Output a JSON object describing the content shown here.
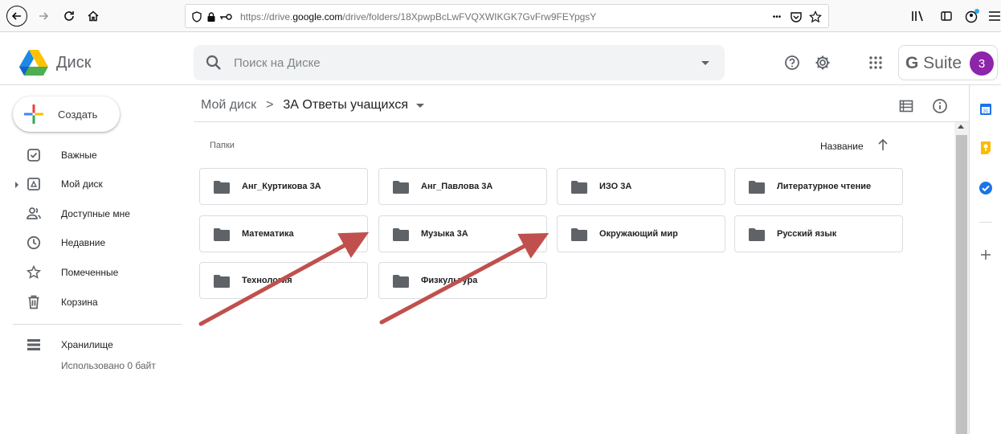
{
  "browser": {
    "url_prefix": "https://drive.",
    "url_domain": "google.com",
    "url_path": "/drive/folders/18XpwpBcLwFVQXWIKGK7GvFrw9FEYpgsY",
    "more_glyph": "•••"
  },
  "header": {
    "logo_text": "Диск",
    "search_placeholder": "Поиск на Диске",
    "gsuite_g": "G",
    "gsuite_rest": " Suite",
    "avatar_letter": "3"
  },
  "sidebar": {
    "create_label": "Создать",
    "items": [
      {
        "label": "Важные",
        "icon": "checkbox-icon"
      },
      {
        "label": "Мой диск",
        "icon": "drive-icon"
      },
      {
        "label": "Доступные мне",
        "icon": "people-icon"
      },
      {
        "label": "Недавние",
        "icon": "clock-icon"
      },
      {
        "label": "Помеченные",
        "icon": "star-icon"
      },
      {
        "label": "Корзина",
        "icon": "trash-icon"
      }
    ],
    "storage_label": "Хранилище",
    "storage_used": "Использовано 0 байт"
  },
  "breadcrumb": {
    "root": "Мой диск",
    "separator": ">",
    "current": "3А Ответы учащихся"
  },
  "main": {
    "section_label": "Папки",
    "sort_label": "Название",
    "folders": [
      "Анг_Куртикова 3А",
      "Анг_Павлова 3А",
      "ИЗО 3А",
      "Литературное чтение",
      "Математика",
      "Музыка 3А",
      "Окружающий мир",
      "Русский язык",
      "Технология",
      "Физкультура"
    ]
  },
  "colors": {
    "annotation_arrow": "#c0504d",
    "avatar": "#8e24aa"
  }
}
